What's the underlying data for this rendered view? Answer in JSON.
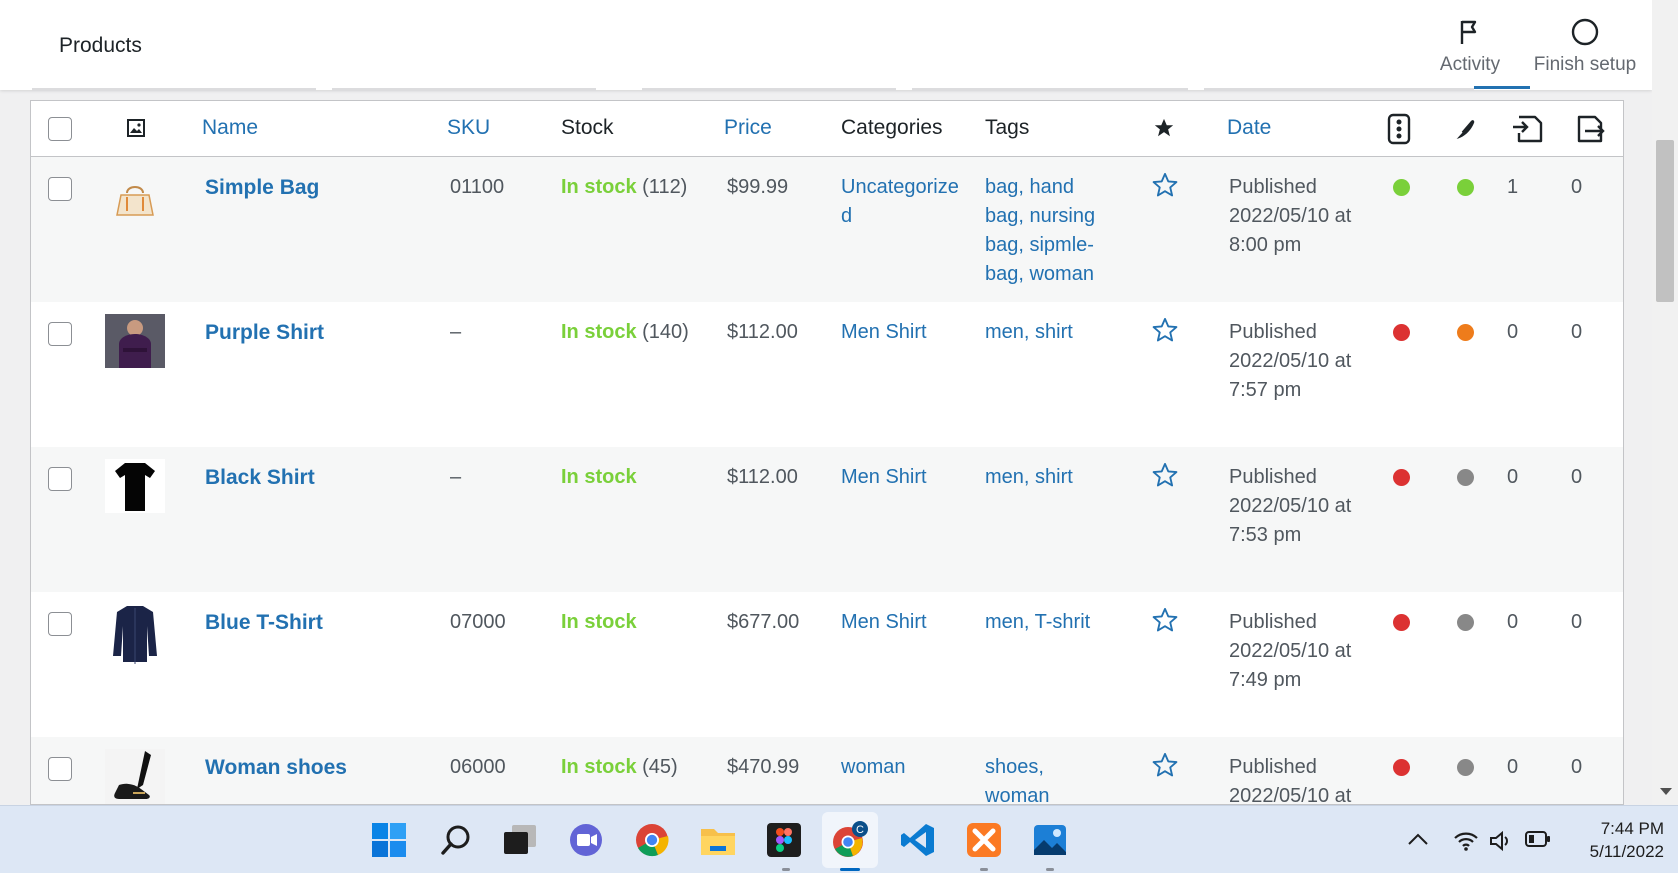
{
  "header": {
    "title": "Products",
    "actions": [
      {
        "label": "Activity",
        "icon": "flag-icon"
      },
      {
        "label": "Finish setup",
        "icon": "circle-icon"
      }
    ]
  },
  "table": {
    "columns": {
      "name": "Name",
      "sku": "SKU",
      "stock": "Stock",
      "price": "Price",
      "categories": "Categories",
      "tags": "Tags",
      "date": "Date"
    },
    "rows": [
      {
        "name": "Simple Bag",
        "thumb": "bag",
        "sku": "01100",
        "stock_status": "In stock",
        "stock_count": "(112)",
        "price": "$99.99",
        "categories": "Uncategorized",
        "tags": "bag, hand bag, nursing bag, sipmle-bag, woman",
        "date_status": "Published",
        "date_value": "2022/05/10 at 8:00 pm",
        "dot1": "#7ad03a",
        "dot2": "#7ad03a",
        "n1": "1",
        "n2": "0"
      },
      {
        "name": "Purple Shirt",
        "thumb": "purple-shirt",
        "sku": "–",
        "stock_status": "In stock",
        "stock_count": "(140)",
        "price": "$112.00",
        "categories": "Men Shirt",
        "tags": "men, shirt",
        "date_status": "Published",
        "date_value": "2022/05/10 at 7:57 pm",
        "dot1": "#dc3232",
        "dot2": "#ee7c1b",
        "n1": "0",
        "n2": "0"
      },
      {
        "name": "Black Shirt",
        "thumb": "black-shirt",
        "sku": "–",
        "stock_status": "In stock",
        "stock_count": "",
        "price": "$112.00",
        "categories": "Men Shirt",
        "tags": "men, shirt",
        "date_status": "Published",
        "date_value": "2022/05/10 at 7:53 pm",
        "dot1": "#dc3232",
        "dot2": "#888888",
        "n1": "0",
        "n2": "0"
      },
      {
        "name": "Blue T-Shirt",
        "thumb": "blue-shirt",
        "sku": "07000",
        "stock_status": "In stock",
        "stock_count": "",
        "price": "$677.00",
        "categories": "Men Shirt",
        "tags": "men, T-shrit",
        "date_status": "Published",
        "date_value": "2022/05/10 at 7:49 pm",
        "dot1": "#dc3232",
        "dot2": "#888888",
        "n1": "0",
        "n2": "0"
      },
      {
        "name": "Woman shoes",
        "thumb": "shoes",
        "sku": "06000",
        "stock_status": "In stock",
        "stock_count": "(45)",
        "price": "$470.99",
        "categories": "woman",
        "tags": "shoes, woman",
        "date_status": "Published",
        "date_value": "2022/05/10 at",
        "dot1": "#dc3232",
        "dot2": "#888888",
        "n1": "0",
        "n2": "0"
      }
    ]
  },
  "taskbar": {
    "apps": [
      "windows-start-icon",
      "search-icon",
      "task-view-icon",
      "teams-icon",
      "chrome-icon",
      "file-explorer-icon",
      "figma-icon",
      "chrome-profile-icon",
      "vscode-icon",
      "xampp-icon",
      "photos-icon"
    ],
    "tray": [
      "chevron-up-icon",
      "wifi-icon",
      "speaker-icon",
      "battery-icon"
    ],
    "time": "7:44 PM",
    "date": "5/11/2022"
  },
  "colors": {
    "link": "#2271b1",
    "in_stock": "#7ad03a",
    "taskbar_bg": "#dde7f5"
  }
}
